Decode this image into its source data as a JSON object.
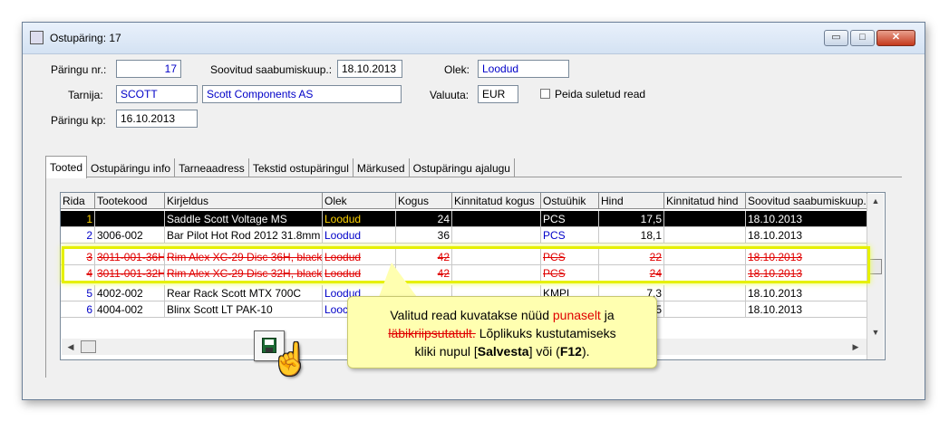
{
  "window": {
    "title": "Ostupäring: 17",
    "controls": {
      "minimize": "▭",
      "maximize": "□",
      "close": "✕"
    }
  },
  "form": {
    "paringu_nr": {
      "label": "Päringu nr.:",
      "value": "17"
    },
    "soovitud": {
      "label": "Soovitud saabumiskuup.:",
      "value": "18.10.2013"
    },
    "olek": {
      "label": "Olek:",
      "value": "Loodud"
    },
    "tarnija": {
      "label": "Tarnija:",
      "code": "SCOTT",
      "name": "Scott Components AS"
    },
    "valuuta": {
      "label": "Valuuta:",
      "value": "EUR"
    },
    "peida": {
      "label": "Peida suletud read",
      "checked": false
    },
    "paringu_kp": {
      "label": "Päringu kp:",
      "value": "16.10.2013"
    }
  },
  "tabs": [
    "Tooted",
    "Ostupäringu info",
    "Tarneaadress",
    "Tekstid ostupäringul",
    "Märkused",
    "Ostupäringu ajalugu"
  ],
  "grid": {
    "headers": [
      "Rida",
      "Tootekood",
      "Kirjeldus",
      "Olek",
      "Kogus",
      "Kinnitatud kogus",
      "Ostuühik",
      "Hind",
      "Kinnitatud hind",
      "Soovitud saabumiskuup."
    ],
    "rows": [
      {
        "rida": "1",
        "kood": "",
        "kirjeldus": "Saddle Scott Voltage MS",
        "olek": "Loodud",
        "kogus": "24",
        "kinnitatud_kogus": "",
        "uhik": "PCS",
        "hind": "17,5",
        "kinnitatud_hind": "",
        "kuup": "18.10.2013"
      },
      {
        "rida": "2",
        "kood": "3006-002",
        "kirjeldus": "Bar Pilot Hot Rod 2012 31.8mm Bl",
        "olek": "Loodud",
        "kogus": "36",
        "kinnitatud_kogus": "",
        "uhik": "PCS",
        "hind": "18,1",
        "kinnitatud_hind": "",
        "kuup": "18.10.2013"
      },
      {
        "rida": "3",
        "kood": "3011-001-36H",
        "kirjeldus": "Rim Alex XC-29 Disc 36H, black",
        "olek": "Loodud",
        "kogus": "42",
        "kinnitatud_kogus": "",
        "uhik": "PCS",
        "hind": "22",
        "kinnitatud_hind": "",
        "kuup": "18.10.2013"
      },
      {
        "rida": "4",
        "kood": "3011-001-32H",
        "kirjeldus": "Rim Alex XC-29 Disc 32H, black",
        "olek": "Loodud",
        "kogus": "42",
        "kinnitatud_kogus": "",
        "uhik": "PCS",
        "hind": "24",
        "kinnitatud_hind": "",
        "kuup": "18.10.2013"
      },
      {
        "rida": "5",
        "kood": "4002-002",
        "kirjeldus": "Rear Rack Scott MTX 700C",
        "olek": "Loodud",
        "kogus": "",
        "kinnitatud_kogus": "",
        "uhik": "KMPL",
        "hind": "7,3",
        "kinnitatud_hind": "",
        "kuup": "18.10.2013"
      },
      {
        "rida": "6",
        "kood": "4004-002",
        "kirjeldus": "Blinx Scott LT PAK-10",
        "olek": "Looc",
        "kogus": "",
        "kinnitatud_kogus": "",
        "uhik": "",
        "hind": "5",
        "kinnitatud_hind": "",
        "kuup": "18.10.2013"
      }
    ]
  },
  "callout": {
    "line1_prefix": "Valitud read kuvatakse nüüd ",
    "line1_red": "punaselt",
    "line1_suffix": " ja",
    "line2_strike": "läbikriipsutatult.",
    "line2_suffix": " Lõplikuks kustutamiseks",
    "line3_prefix": "kliki nupul [",
    "line3_bold1": "Salvesta",
    "line3_mid": "] või (",
    "line3_bold2": "F12",
    "line3_suffix": ")."
  },
  "icons": {
    "save": "floppy-disk-icon",
    "cursor": "hand-pointer-icon",
    "cursor_glyph": "☝"
  },
  "colors": {
    "deleted_row": "#e00000",
    "highlight": "#e6f000",
    "callout_bg": "#ffffb0",
    "selected_olek": "#ffd400"
  }
}
